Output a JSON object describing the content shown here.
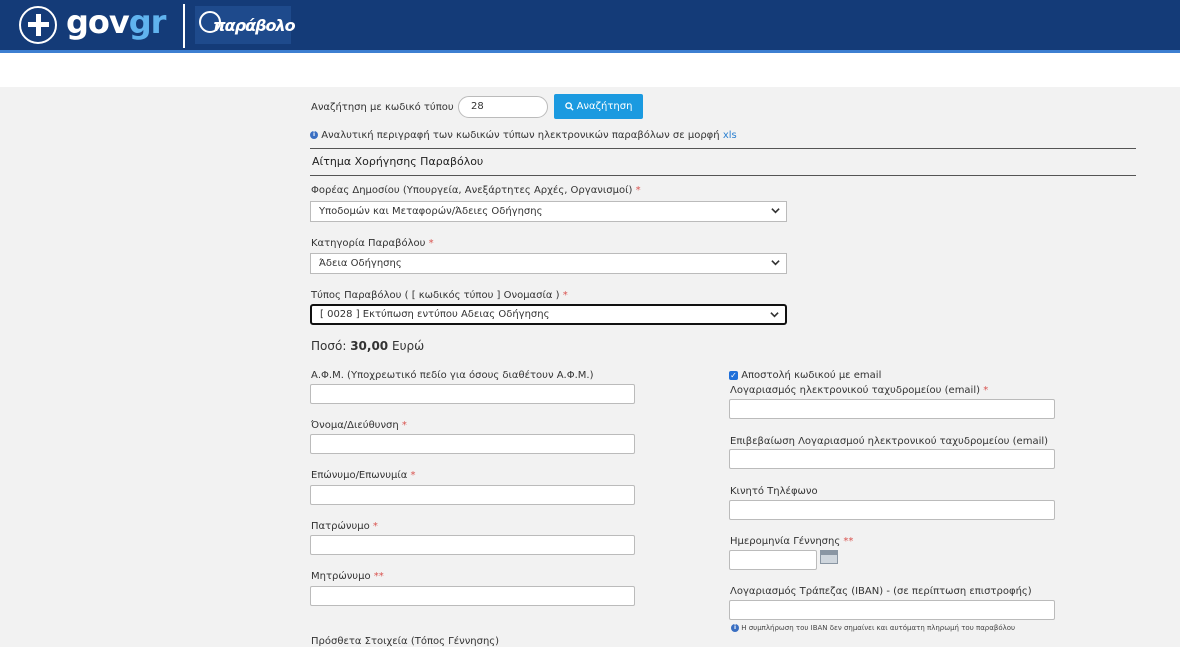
{
  "header": {
    "gov_brand_main": "gov",
    "gov_brand_accent": "gr",
    "app_logo": "παράβολο",
    "colors": {
      "bar": "#143b78",
      "accent_line": "#3d7fd1"
    }
  },
  "search": {
    "label": "Αναζήτηση με κωδικό τύπου",
    "value": "28",
    "button_label": "Αναζήτηση",
    "info_text": "Αναλυτική περιγραφή των κωδικών τύπων ηλεκτρονικών παραβόλων σε μορφή",
    "info_link": "xls"
  },
  "section": {
    "title": "Αίτημα Χορήγησης Παραβόλου"
  },
  "fields": {
    "agency": {
      "label": "Φορέας Δημοσίου (Υπουργεία, Ανεξάρτητες Αρχές, Οργανισμοί)",
      "value": "Υποδομών και Μεταφορών/Άδειες Οδήγησης"
    },
    "category": {
      "label": "Κατηγορία Παραβόλου",
      "value": "Άδεια Οδήγησης"
    },
    "type": {
      "label": "Τύπος Παραβόλου ( [ κωδικός τύπου ] Ονομασία )",
      "value": "[ 0028 ] Εκτύπωση εντύπου Αδειας Οδήγησης"
    }
  },
  "amount": {
    "prefix": "Ποσό:",
    "value": "30,00",
    "currency": "Ευρώ"
  },
  "left_form": {
    "afm_label": "Α.Φ.Μ. (Υποχρεωτικό πεδίο για όσους διαθέτουν Α.Φ.Μ.)",
    "name_label": "Όνομα/Διεύθυνση",
    "surname_label": "Επώνυμο/Επωνυμία",
    "father_label": "Πατρώνυμο",
    "mother_label": "Μητρώνυμο",
    "extra_label": "Πρόσθετα Στοιχεία (Τόπος Γέννησης)"
  },
  "right_form": {
    "send_email_label": "Αποστολή κωδικού με email",
    "email_label": "Λογαριασμός ηλεκτρονικού ταχυδρομείου (email)",
    "email_confirm_label": "Επιβεβαίωση Λογαριασμού ηλεκτρονικού ταχυδρομείου (email)",
    "mobile_label": "Κινητό Τηλέφωνο",
    "dob_label": "Ημερομηνία Γέννησης",
    "iban_label": "Λογαριασμός Τράπεζας (IBAN) - (σε περίπτωση επιστροφής)",
    "iban_note": "Η συμπλήρωση του IBAN δεν σημαίνει και αυτόματη πληρωμή του παραβόλου"
  },
  "required_mark": "*",
  "double_required_mark": "**"
}
